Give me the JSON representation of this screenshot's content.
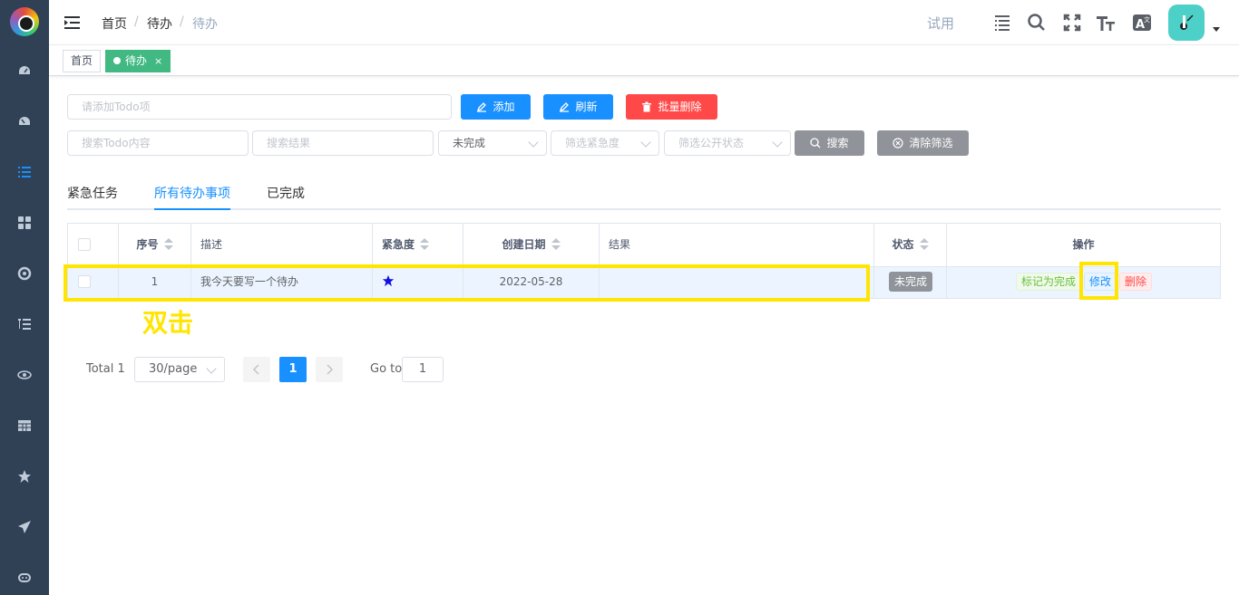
{
  "breadcrumb": [
    "首页",
    "待办",
    "待办"
  ],
  "header": {
    "trial": "试用"
  },
  "tags": [
    {
      "label": "首页"
    },
    {
      "label": "待办",
      "close": "×"
    }
  ],
  "form": {
    "add_placeholder": "请添加Todo项",
    "add_button": "添加",
    "refresh_button": "刷新",
    "batch_delete_button": "批量删除",
    "search_content_placeholder": "搜索Todo内容",
    "search_result_placeholder": "搜索结果",
    "status_select": "未完成",
    "urgency_placeholder": "筛选紧急度",
    "public_placeholder": "筛选公开状态",
    "search_button": "搜索",
    "clear_button": "清除筛选"
  },
  "tabs": [
    "紧急任务",
    "所有待办事项",
    "已完成"
  ],
  "table": {
    "headers": [
      "序号",
      "描述",
      "紧急度",
      "创建日期",
      "结果",
      "状态",
      "操作"
    ],
    "rows": [
      {
        "index": "1",
        "desc": "我今天要写一个待办",
        "urgency_stars": 1,
        "date": "2022-05-28",
        "result": "",
        "status": "未完成",
        "ops": [
          "标记为完成",
          "修改",
          "删除"
        ]
      }
    ]
  },
  "annotation": {
    "text": "双击"
  },
  "pagination": {
    "total": "Total 1",
    "page_size": "30/page",
    "current": "1",
    "goto_label": "Go to",
    "goto_value": "1"
  },
  "colors": {
    "primary": "#1890ff",
    "danger": "#ff4949",
    "info": "#909399",
    "highlight": "#ffe500",
    "sidebar": "#304156"
  }
}
